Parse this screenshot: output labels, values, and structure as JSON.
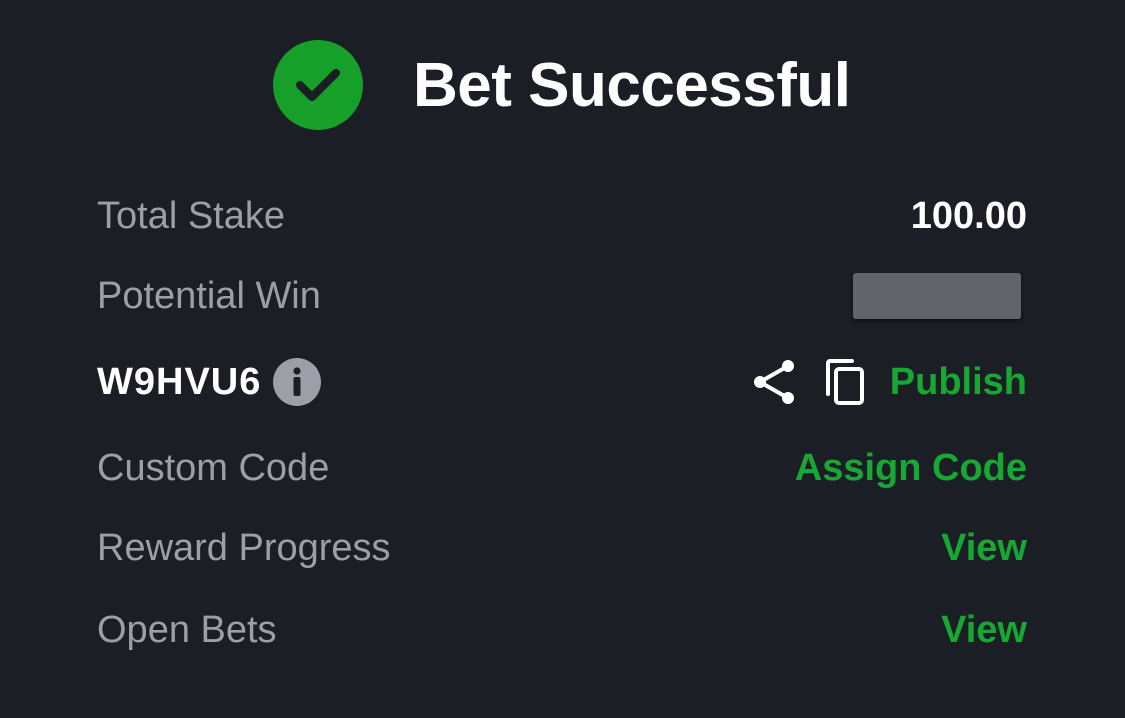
{
  "header": {
    "title": "Bet Successful",
    "icon": "check-circle-icon",
    "accent_color": "#16a02a"
  },
  "rows": {
    "total_stake": {
      "label": "Total Stake",
      "value": "100.00"
    },
    "potential_win": {
      "label": "Potential Win",
      "value_redacted": true
    },
    "booking_code": {
      "code": "W9HVU6",
      "info_icon": "info-icon",
      "share_icon": "share-icon",
      "copy_icon": "copy-icon",
      "publish_label": "Publish"
    },
    "custom_code": {
      "label": "Custom Code",
      "action_label": "Assign Code"
    },
    "reward_progress": {
      "label": "Reward Progress",
      "action_label": "View"
    },
    "open_bets": {
      "label": "Open Bets",
      "action_label": "View"
    }
  },
  "colors": {
    "background": "#1b1e25",
    "label": "#9c9fa8",
    "value": "#ffffff",
    "link": "#17a834"
  }
}
